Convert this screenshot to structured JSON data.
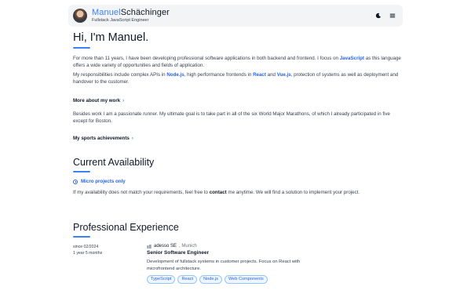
{
  "header": {
    "first_name": "Manuel",
    "last_name": "Schächinger",
    "role": "Fullstack JavaScript Engineer"
  },
  "intro": {
    "heading": "Hi, I'm Manuel.",
    "p1_a": "For more than 11 years, I have been developing professional software applications in both backend and frontend. I focus on ",
    "p1_link": "JavaScript",
    "p1_b": " as this language offers a wide variety of opportunities and fields of application.",
    "p2_a": "My responsibilities include complex APIs in ",
    "p2_link1": "Node.js",
    "p2_b": ", high performance frontends in ",
    "p2_link2": "React",
    "p2_c": " and ",
    "p2_link3": "Vue.js",
    "p2_d": ", protection of systems as well as deployment and handover to the customer.",
    "more_work": "More about my work",
    "p3": "Besides work I am a passionate runner. My ultimate goal is to take part in all of the six World Major Marathons, of which I already participated in five except for Boston.",
    "sports": "My sports achievements"
  },
  "availability": {
    "heading": "Current Availability",
    "status": "Micro projects only",
    "note_a": "If my availability does not match your requirements, feel free to ",
    "note_link": "contact",
    "note_b": " me anytime. We will find a solution to implement your project."
  },
  "experience": {
    "heading": "Professional Experience",
    "items": [
      {
        "since": "since 02/2024",
        "duration": "1 year 5 months",
        "company": "adesso SE",
        "location": ", Munich",
        "role": "Senior Software Engineer",
        "description": "Development of fullstack systems in customer projects. Focus on React with microfrontend architecture.",
        "tags": [
          "TypeScript",
          "React",
          "Node.js",
          "Web Components"
        ]
      }
    ]
  },
  "colors": {
    "accent": "#3b82f6",
    "link": "#2563eb",
    "header_bg": "#f3f4f6"
  },
  "icons": [
    "avatar",
    "moon-icon",
    "menu-icon",
    "clock-icon",
    "building-icon",
    "chevron-right-icon"
  ]
}
